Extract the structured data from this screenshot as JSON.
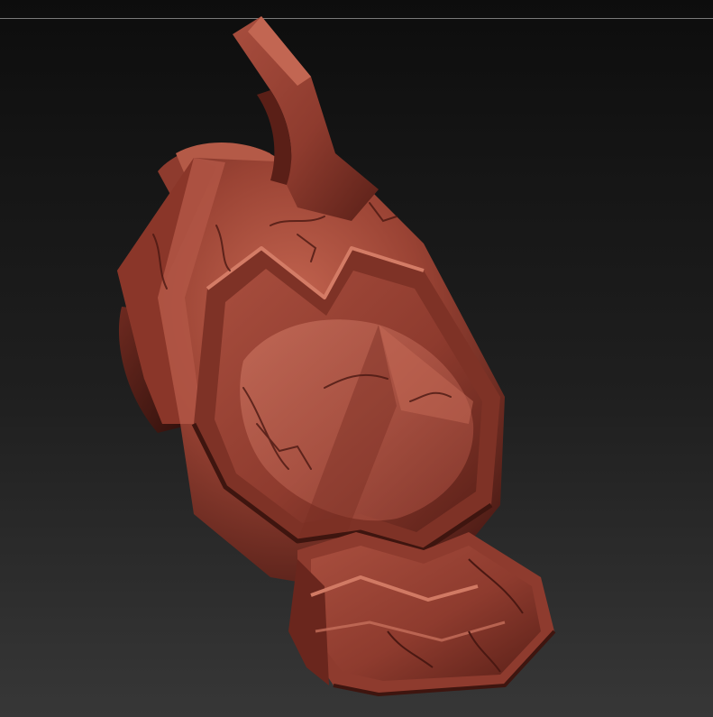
{
  "viewport": {
    "mode": "3d-sculpt-view",
    "background_top": "#0d0d0d",
    "background_bottom": "#373737"
  },
  "model": {
    "subject": "armor-gauntlet-sculpt",
    "material_color": "#8a3a2c",
    "highlight_color": "#c86a57",
    "shadow_color": "#3a1410"
  }
}
